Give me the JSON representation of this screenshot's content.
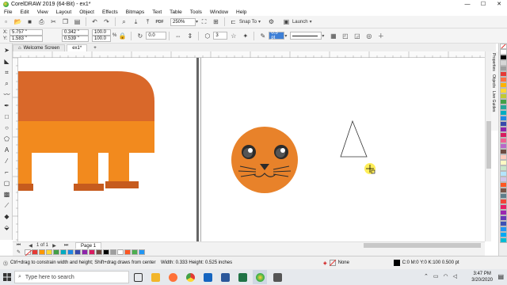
{
  "window": {
    "title": "CorelDRAW 2019 (64-Bit) - ex1*",
    "controls": [
      "—",
      "☐",
      "✕"
    ]
  },
  "menu": [
    "File",
    "Edit",
    "View",
    "Layout",
    "Object",
    "Effects",
    "Bitmaps",
    "Text",
    "Table",
    "Tools",
    "Window",
    "Help"
  ],
  "toolbar": {
    "zoom": "250%",
    "snap_to": "Snap To",
    "launch": "Launch"
  },
  "property_bar": {
    "x": "5.757 \"",
    "y": "1.583 \"",
    "width": "0.342 \"",
    "height": "0.539 \"",
    "scale_w": "100.0",
    "scale_h": "100.0",
    "scale_unit": "%",
    "angle": "0.0",
    "sides": "3",
    "outline_width": "0.5 pt",
    "x_label": "X:",
    "y_label": "Y:"
  },
  "tabs": [
    "Welcome Screen",
    "ex1*"
  ],
  "docker_tabs": [
    "Properties",
    "Objects",
    "Live Guides"
  ],
  "page_tab": "Page 1",
  "page_nav": "1 of 1",
  "status": {
    "hint": "Ctrl+drag to constrain width and height; Shift+drag draws from center",
    "dimensions": "Width: 0.333  Height: 0.525  inches",
    "fill": "None",
    "outline": "C:0 M:0 Y:0 K:100  0.500 pt"
  },
  "taskbar": {
    "search_placeholder": "Type here to search",
    "time": "3:47 PM",
    "date": "3/20/2020"
  },
  "colors": {
    "orange": "#e8822a",
    "dark_orange": "#d9682a",
    "brown": "#c65b1e",
    "accent": "#1a73c7"
  },
  "palette_colors": [
    "#ffffff",
    "#000000",
    "#d6d6d6",
    "#9e9e9e",
    "#e53935",
    "#ff7043",
    "#ffb300",
    "#fdd835",
    "#c0ca33",
    "#43a047",
    "#26a69a",
    "#00acc1",
    "#1e88e5",
    "#3949ab",
    "#8e24aa",
    "#d81b60",
    "#f06292",
    "#ba68c8",
    "#6d4c41",
    "#ffccbc",
    "#fff9c4",
    "#c8e6c9",
    "#b3e5fc",
    "#d1c4e9",
    "#ff5722",
    "#795548",
    "#607d8b",
    "#f44336",
    "#e91e63",
    "#9c27b0",
    "#673ab7",
    "#3f51b5",
    "#2196f3",
    "#03a9f4",
    "#00bcd4"
  ],
  "h_palette_colors": [
    "#e53935",
    "#ff9800",
    "#fdd835",
    "#43a047",
    "#00acc1",
    "#1e88e5",
    "#3949ab",
    "#8e24aa",
    "#d81b60",
    "#6d4c41",
    "#000000",
    "#9e9e9e",
    "#ffffff",
    "#ff5722",
    "#4caf50",
    "#2196f3"
  ]
}
